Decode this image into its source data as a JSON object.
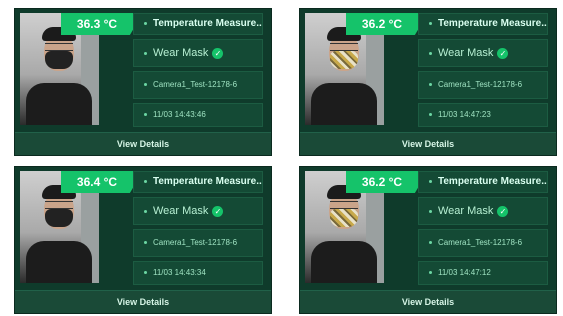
{
  "cards": [
    {
      "temperature": "36.3 °C",
      "title": "Temperature Measure...",
      "mask": "Wear Mask",
      "camera": "Camera1_Test-12178-6",
      "time": "11/03 14:43:46",
      "details": "View Details",
      "mask_style": "black"
    },
    {
      "temperature": "36.2 °C",
      "title": "Temperature Measure...",
      "mask": "Wear Mask",
      "camera": "Camera1_Test-12178-6",
      "time": "11/03 14:47:23",
      "details": "View Details",
      "mask_style": "patterned"
    },
    {
      "temperature": "36.4 °C",
      "title": "Temperature Measure...",
      "mask": "Wear Mask",
      "camera": "Camera1_Test-12178-6",
      "time": "11/03 14:43:34",
      "details": "View Details",
      "mask_style": "black"
    },
    {
      "temperature": "36.2 °C",
      "title": "Temperature Measure...",
      "mask": "Wear Mask",
      "camera": "Camera1_Test-12178-6",
      "time": "11/03 14:47:12",
      "details": "View Details",
      "mask_style": "patterned"
    }
  ],
  "colors": {
    "accent": "#15c36a",
    "card_bg": "#0f3b2b",
    "row_bg": "#144a35"
  },
  "icons": {
    "mask_status": "check-circle-icon"
  }
}
